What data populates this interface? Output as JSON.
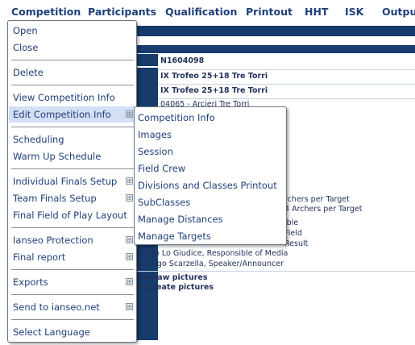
{
  "menubar": {
    "items": [
      "Competition",
      "Participants",
      "Qualification",
      "Printout",
      "HHT",
      "ISK",
      "Output"
    ]
  },
  "main_menu": {
    "items": [
      {
        "label": "Open",
        "submenu": false
      },
      {
        "label": "Close",
        "submenu": false
      },
      {
        "label": "Delete",
        "submenu": false
      },
      {
        "label": "View Competition Info",
        "submenu": false
      },
      {
        "label": "Edit Competition Info",
        "submenu": true,
        "active": true
      },
      {
        "label": "Scheduling",
        "submenu": false
      },
      {
        "label": "Warm Up Schedule",
        "submenu": false
      },
      {
        "label": "Individual Finals Setup",
        "submenu": true
      },
      {
        "label": "Team Finals Setup",
        "submenu": true
      },
      {
        "label": "Final Field of Play Layout",
        "submenu": false
      },
      {
        "label": "Ianseo Protection",
        "submenu": true
      },
      {
        "label": "Final report",
        "submenu": true
      },
      {
        "label": "Exports",
        "submenu": true
      },
      {
        "label": "Send to ianseo.net",
        "submenu": true
      },
      {
        "label": "Select Language",
        "submenu": false
      }
    ],
    "submenu_glyph": "⊞"
  },
  "submenu": {
    "items": [
      "Competition Info",
      "Images",
      "Session",
      "Field Crew",
      "Divisions and Classes Printout",
      "SubClasses",
      "Manage Distances",
      "Manage Targets"
    ]
  },
  "page": {
    "code": "N1604098",
    "name1": "IX Trofeo 25+18 Tre Torri",
    "name2": "IX Trofeo 25+18 Tre Torri",
    "organizer": "04065 - Arcieri Tre Torri",
    "target1": "rchers per Target",
    "target2": "4 Archers per Target",
    "role1": "ible",
    "role2": "Field",
    "role3": "Result",
    "crew1": "Guido Lo Giudice, Responsible of Media",
    "crew2": "Ardingo Scarzella, Speaker/Announcer",
    "redraw": "Redraw pictures",
    "recreate": "Recreate pictures"
  },
  "colors": {
    "menu_text": "#1f3f7a",
    "header_bar": "#163b6c",
    "active_item_bg": "#d3dff3"
  }
}
